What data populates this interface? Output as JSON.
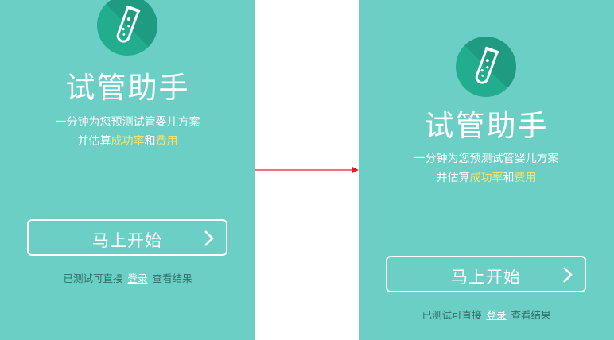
{
  "app": {
    "title": "试管助手",
    "subtitle_line1": "一分钟为您预测试管婴儿方案",
    "subtitle_line2_prefix": "并估算",
    "subtitle_highlight1": "成功率",
    "subtitle_conjunction": "和",
    "subtitle_highlight2": "费用",
    "start_button": "马上开始",
    "footer_prefix": "已测试可直接",
    "footer_login": "登录",
    "footer_suffix": "查看结果"
  },
  "icons": {
    "logo": "test-tube-icon",
    "button": "chevron-right-icon",
    "transition": "arrow-right-icon"
  },
  "colors": {
    "background": "#6bcfc6",
    "logo_circle": "#22ad8f",
    "highlight": "#f6e36a",
    "footer_text": "#2f6f68",
    "arrow": "#e02020"
  }
}
